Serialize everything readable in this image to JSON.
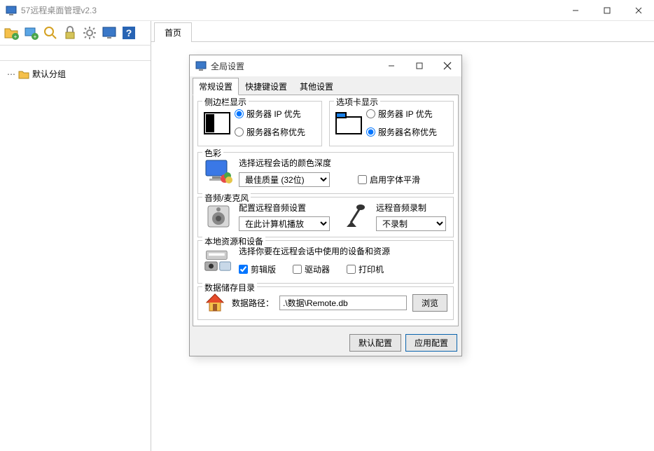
{
  "app": {
    "title": "57远程桌面管理v2.3"
  },
  "sidebar": {
    "default_group": "默认分组"
  },
  "tabs": {
    "home": "首页"
  },
  "dialog": {
    "title": "全局设置",
    "tabs": {
      "general": "常规设置",
      "shortcut": "快捷键设置",
      "other": "其他设置"
    },
    "sidebar_display": {
      "title": "侧边栏显示",
      "opt_ip": "服务器 IP 优先",
      "opt_name": "服务器名称优先"
    },
    "tab_display": {
      "title": "选项卡显示",
      "opt_ip": "服务器 IP 优先",
      "opt_name": "服务器名称优先"
    },
    "color": {
      "title": "色彩",
      "desc": "选择远程会话的颜色深度",
      "selected": "最佳质量 (32位)",
      "font_smoothing": "启用字体平滑"
    },
    "audio": {
      "title": "音频/麦克风",
      "desc": "配置远程音频设置",
      "play_selected": "在此计算机播放",
      "record_label": "远程音频录制",
      "record_selected": "不录制"
    },
    "devices": {
      "title": "本地资源和设备",
      "desc": "选择你要在远程会话中使用的设备和资源",
      "clipboard": "剪辑版",
      "drives": "驱动器",
      "printers": "打印机"
    },
    "data_dir": {
      "title": "数据储存目录",
      "label": "数据路径：",
      "path": ".\\数据\\Remote.db",
      "browse": "浏览"
    },
    "footer": {
      "default": "默认配置",
      "apply": "应用配置"
    }
  }
}
